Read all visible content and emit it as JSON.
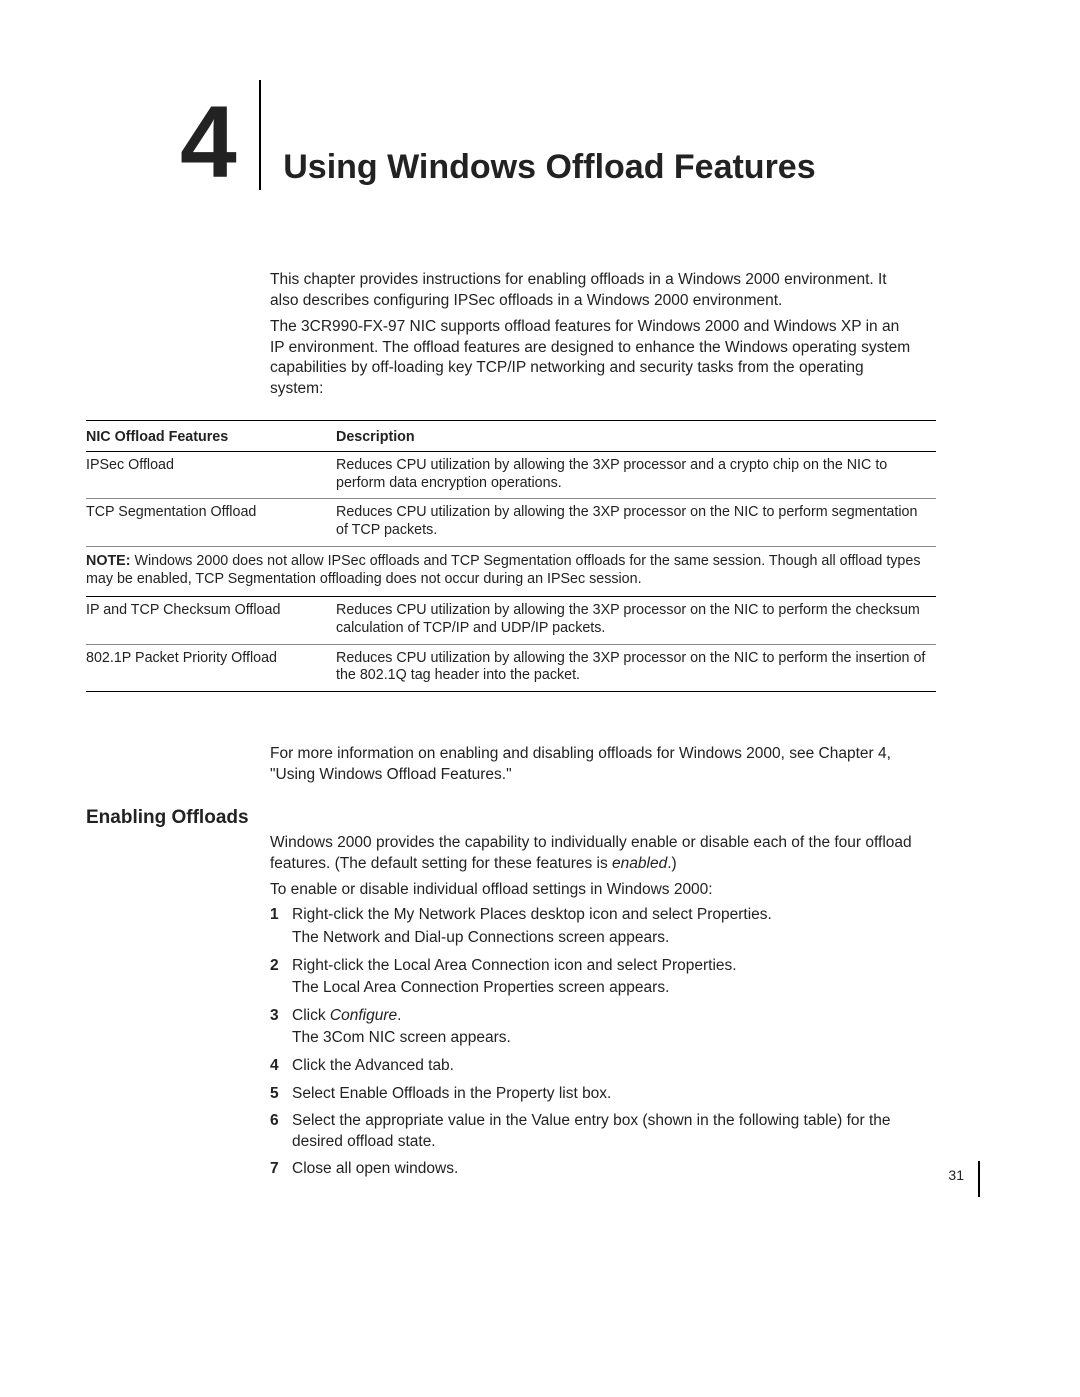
{
  "chapter": {
    "number": "4",
    "title": "Using Windows Offload Features"
  },
  "intro": {
    "p1": "This chapter provides instructions for enabling offloads in a Windows 2000 environment. It also describes configuring IPSec offloads in a Windows 2000 environment.",
    "p2": "The 3CR990-FX-97 NIC supports offload features for Windows 2000 and Windows XP in an IP environment. The offload features are designed to enhance the Windows operating system capabilities by off-loading key TCP/IP networking and security tasks from the operating system:"
  },
  "table": {
    "headers": {
      "col1": "NIC Offload Features",
      "col2": "Description"
    },
    "rows": [
      {
        "feature": "IPSec Offload",
        "desc": "Reduces CPU utilization by allowing the 3XP processor and a crypto chip on the NIC to perform data encryption operations."
      },
      {
        "feature": "TCP Segmentation Offload",
        "desc": "Reduces CPU utilization by allowing the 3XP processor on the NIC to perform segmentation of TCP packets."
      }
    ],
    "note_label": "NOTE:",
    "note": " Windows 2000 does not allow IPSec offloads and TCP Segmentation offloads for the same session. Though all offload types may be enabled, TCP Segmentation offloading does not occur during an IPSec session.",
    "rows2": [
      {
        "feature": "IP and TCP Checksum Offload",
        "desc": "Reduces CPU utilization by allowing the 3XP processor on the NIC to perform the checksum calculation of TCP/IP and UDP/IP packets."
      },
      {
        "feature": "802.1P Packet Priority Offload",
        "desc": "Reduces CPU utilization by allowing the 3XP processor on the NIC to perform the insertion of the 802.1Q tag header into the packet."
      }
    ]
  },
  "post_table": "For more information on enabling and disabling offloads for Windows 2000, see Chapter 4,   \"Using Windows Offload Features.\"",
  "section": {
    "heading": "Enabling Offloads",
    "p1a": "Windows 2000 provides the capability to individually enable or disable each of the four offload features. (The default setting for these features is ",
    "p1b": "enabled",
    "p1c": ".)",
    "p2": "To enable or disable individual offload settings in Windows 2000:",
    "steps": [
      {
        "main": "Right-click the My Network Places desktop icon and select Properties.",
        "sub": "The Network and Dial-up Connections screen appears."
      },
      {
        "main": "Right-click the Local Area Connection icon and select Properties.",
        "sub": "The Local Area Connection Properties screen appears."
      },
      {
        "mainA": "Click ",
        "italic": "Configure",
        "mainB": ".",
        "sub": "The 3Com NIC screen appears."
      },
      {
        "main": "Click the Advanced tab."
      },
      {
        "main": "Select Enable Offloads in the Property list box."
      },
      {
        "main": "Select the appropriate value in the Value entry box (shown in the following table) for the desired offload state."
      },
      {
        "main": "Close all open windows."
      }
    ]
  },
  "page_number": "31"
}
